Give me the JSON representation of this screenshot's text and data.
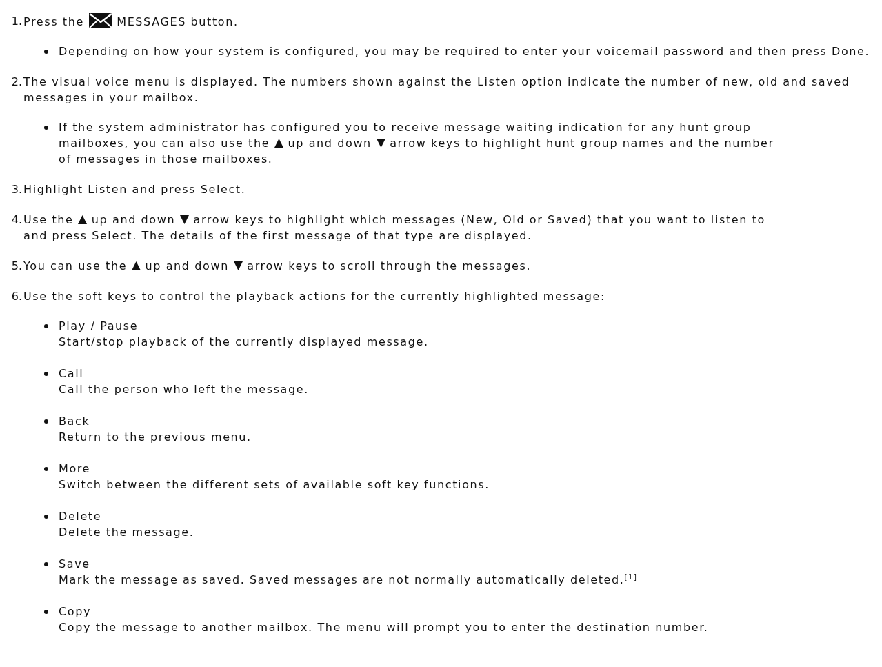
{
  "steps": [
    {
      "number": "1.",
      "parts": [
        {
          "kind": "text",
          "text": "Press the"
        },
        {
          "kind": "envelope"
        },
        {
          "kind": "text",
          "text": "MESSAGES button."
        }
      ],
      "notes": [
        {
          "parts": [
            {
              "kind": "text",
              "text": "Depending on how your system is configured, you may be required to enter your voicemail password and then press Done."
            }
          ]
        }
      ]
    },
    {
      "number": "2.",
      "parts": [
        {
          "kind": "text",
          "text": "The visual voice menu is displayed. The numbers shown against the Listen option indicate the number of new, old and saved messages in your mailbox."
        }
      ],
      "notes": [
        {
          "parts": [
            {
              "kind": "text",
              "text": "If the system administrator has configured you to receive message waiting indication for any hunt group"
            },
            {
              "kind": "text",
              "text": "mailboxes, you can also use the"
            },
            {
              "kind": "up"
            },
            {
              "kind": "text",
              "text": "up and down"
            },
            {
              "kind": "down"
            },
            {
              "kind": "text",
              "text": "arrow keys to highlight hunt group names and the number"
            },
            {
              "kind": "text",
              "text": "of messages in those mailboxes."
            }
          ]
        }
      ]
    },
    {
      "number": "3.",
      "parts": [
        {
          "kind": "text",
          "text": "Highlight Listen and press Select."
        }
      ]
    },
    {
      "number": "4.",
      "parts": [
        {
          "kind": "text",
          "text": "Use the"
        },
        {
          "kind": "up"
        },
        {
          "kind": "text",
          "text": "up and down"
        },
        {
          "kind": "down"
        },
        {
          "kind": "text",
          "text": "arrow keys to highlight which messages (New, Old or Saved) that you want to listen to"
        },
        {
          "kind": "text",
          "text": "and press Select. The details of the first message of that type are displayed."
        }
      ]
    },
    {
      "number": "5.",
      "parts": [
        {
          "kind": "text",
          "text": "You can use the"
        },
        {
          "kind": "up"
        },
        {
          "kind": "text",
          "text": "up and down"
        },
        {
          "kind": "down"
        },
        {
          "kind": "text",
          "text": "arrow keys to scroll through the messages."
        }
      ]
    },
    {
      "number": "6.",
      "parts": [
        {
          "kind": "text",
          "text": "Use the soft keys to control the playback actions for the currently highlighted message:"
        }
      ],
      "soft_keys": [
        {
          "name": "Play / Pause",
          "description": "Start/stop playback of the currently displayed message."
        },
        {
          "name": "Call",
          "description": "Call the person who left the message."
        },
        {
          "name": "Back",
          "description": "Return to the previous menu."
        },
        {
          "name": "More",
          "description": "Switch between the different sets of available soft key functions."
        },
        {
          "name": "Delete",
          "description": "Delete the message."
        },
        {
          "name": "Save",
          "description": "Mark the message as saved. Saved messages are not normally automatically deleted.$^{[1]}$"
        },
        {
          "name": "Copy",
          "description": "Copy the message to another mailbox. The menu will prompt you to enter the destination number."
        }
      ]
    }
  ]
}
